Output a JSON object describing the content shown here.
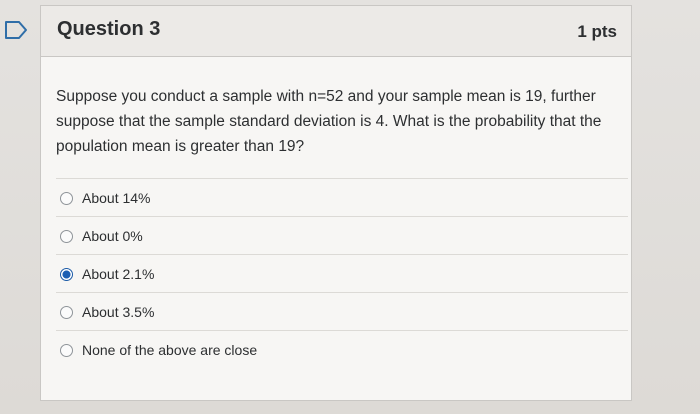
{
  "question": {
    "title": "Question 3",
    "points": "1 pts",
    "text": "Suppose you conduct a sample with n=52 and your sample mean is 19, further suppose that the sample standard deviation is 4. What is the probability that the population mean is greater than 19?"
  },
  "answers": [
    {
      "label": "About 14%",
      "selected": false
    },
    {
      "label": "About 0%",
      "selected": false
    },
    {
      "label": "About 2.1%",
      "selected": true
    },
    {
      "label": "About 3.5%",
      "selected": false
    },
    {
      "label": "None of the above are close",
      "selected": false
    }
  ],
  "colors": {
    "accent": "#1c5fb3",
    "flag": "#2f6ea8"
  }
}
